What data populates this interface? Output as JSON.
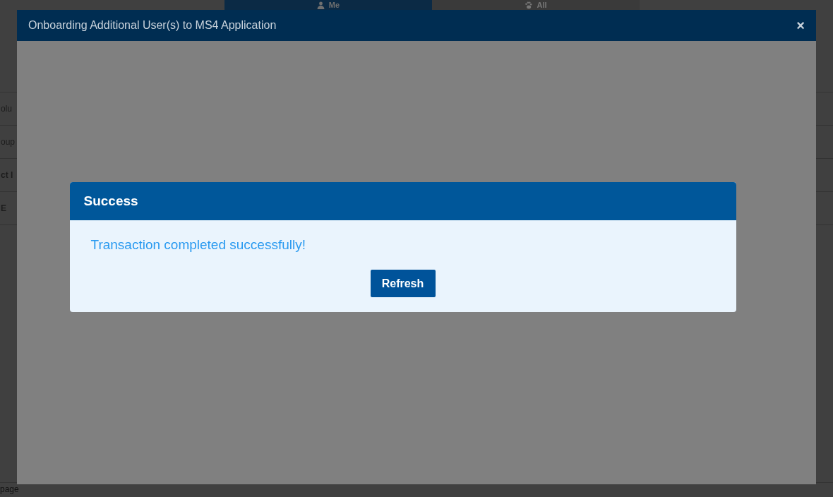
{
  "background": {
    "tabs": [
      {
        "label": "Me",
        "kind": "person",
        "selected": true
      },
      {
        "label": "All",
        "kind": "paw",
        "selected": false
      }
    ],
    "rows": [
      {
        "text": "olu",
        "bold": false
      },
      {
        "text": "oup",
        "bold": false
      },
      {
        "text": "ct I",
        "bold": true
      },
      {
        "text": "E",
        "bold": true
      }
    ],
    "footer": "page"
  },
  "modal": {
    "title": "Onboarding Additional User(s) to MS4 Application",
    "close": "×"
  },
  "dialog": {
    "title": "Success",
    "message": "Transaction completed successfully!",
    "button": "Refresh"
  }
}
